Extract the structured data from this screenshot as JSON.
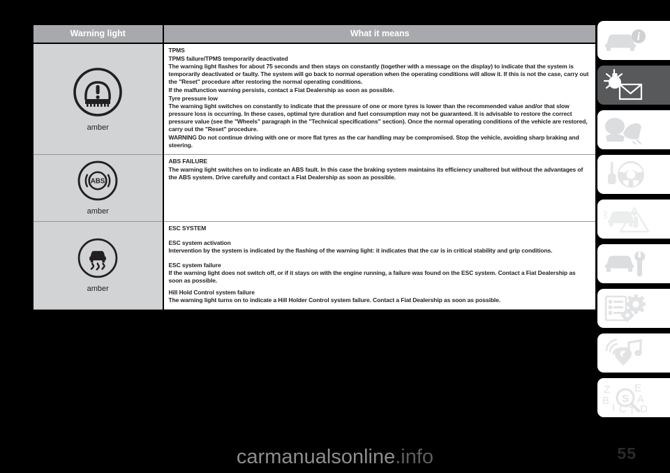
{
  "table": {
    "headers": {
      "warning_light": "Warning light",
      "what_it_means": "What it means"
    },
    "rows": [
      {
        "icon": "tpms-tyre-pressure-icon",
        "colour": "amber",
        "blocks": [
          {
            "style": "lamp-title",
            "text": "TPMS"
          },
          {
            "style": "sub-title",
            "text": "TPMS failure/TPMS temporarily deactivated"
          },
          {
            "style": "body-copy",
            "text": "The warning light flashes for about 75 seconds and then stays on constantly (together with a message on the display) to indicate that the system is temporarily deactivated or faulty. The system will go back to normal operation when the operating conditions will allow it. If this is not the case, carry out the \"Reset\" procedure after restoring the normal operating conditions."
          },
          {
            "style": "body-copy",
            "text": "If the malfunction warning persists, contact a Fiat Dealership as soon as possible."
          },
          {
            "style": "sub-title",
            "text": "Tyre pressure low"
          },
          {
            "style": "body-copy",
            "text": "The warning light switches on constantly to indicate that the pressure of one or more tyres is lower than the recommended value and/or that slow pressure loss is occurring. In these cases, optimal tyre duration and fuel consumption may not be guaranteed. It is advisable to restore the correct pressure value (see the \"Wheels\" paragraph in the \"Technical specifications\" section). Once the normal operating conditions of the vehicle are restored, carry out the \"Reset\" procedure."
          },
          {
            "style": "body-copy",
            "text": "WARNING Do not continue driving with one or more flat tyres as the car handling may be compromised. Stop the vehicle, avoiding sharp braking and steering."
          }
        ]
      },
      {
        "icon": "abs-failure-icon",
        "colour": "amber",
        "blocks": [
          {
            "style": "lamp-title",
            "text": "ABS FAILURE"
          },
          {
            "style": "body-copy",
            "text": "The warning light switches on to indicate an ABS fault. In this case the braking system maintains its efficiency unaltered but without the advantages of the ABS system. Drive carefully and contact a Fiat Dealership as soon as possible."
          }
        ]
      },
      {
        "icon": "esc-skid-icon",
        "colour": "amber",
        "blocks": [
          {
            "style": "lamp-title",
            "text": "ESC SYSTEM"
          },
          {
            "style": "gap-md",
            "text": ""
          },
          {
            "style": "sub-title",
            "text": "ESC system activation"
          },
          {
            "style": "body-copy",
            "text": "Intervention by the system is indicated by the flashing of the warning light: it indicates that the car is in critical stability and grip conditions."
          },
          {
            "style": "gap-md",
            "text": ""
          },
          {
            "style": "sub-title",
            "text": "ESC system failure"
          },
          {
            "style": "body-copy",
            "text": "If the warning light does not switch off, or if it stays on with the engine running, a failure was found on the ESC system. Contact a Fiat Dealership as soon as possible."
          },
          {
            "style": "gap-sm",
            "text": ""
          },
          {
            "style": "sub-title",
            "text": "Hill Hold Control system failure"
          },
          {
            "style": "body-copy",
            "text": "The warning light turns on to indicate a Hill Holder Control system failure. Contact a Fiat Dealership as soon as possible."
          }
        ]
      }
    ]
  },
  "tabs": [
    {
      "name": "dashboard-and-controls",
      "icon": "car-info-icon",
      "active": false
    },
    {
      "name": "warning-lights-messages",
      "icon": "bulb-envelope-icon",
      "active": true
    },
    {
      "name": "safety",
      "icon": "airbag-icon",
      "active": false
    },
    {
      "name": "starting-and-driving",
      "icon": "key-steering-icon",
      "active": false
    },
    {
      "name": "in-an-emergency",
      "icon": "car-hazard-icon",
      "active": false
    },
    {
      "name": "maintenance-and-care",
      "icon": "car-wrench-icon",
      "active": false
    },
    {
      "name": "technical-specifications",
      "icon": "list-gears-icon",
      "active": false
    },
    {
      "name": "multimedia",
      "icon": "music-radio-icon",
      "active": false
    },
    {
      "name": "alphabetical-index",
      "icon": "index-magnifier-icon",
      "active": false
    }
  ],
  "footer": {
    "page_number": "55",
    "watermark_main": "carmanualsonline",
    "watermark_suffix": ".info"
  }
}
